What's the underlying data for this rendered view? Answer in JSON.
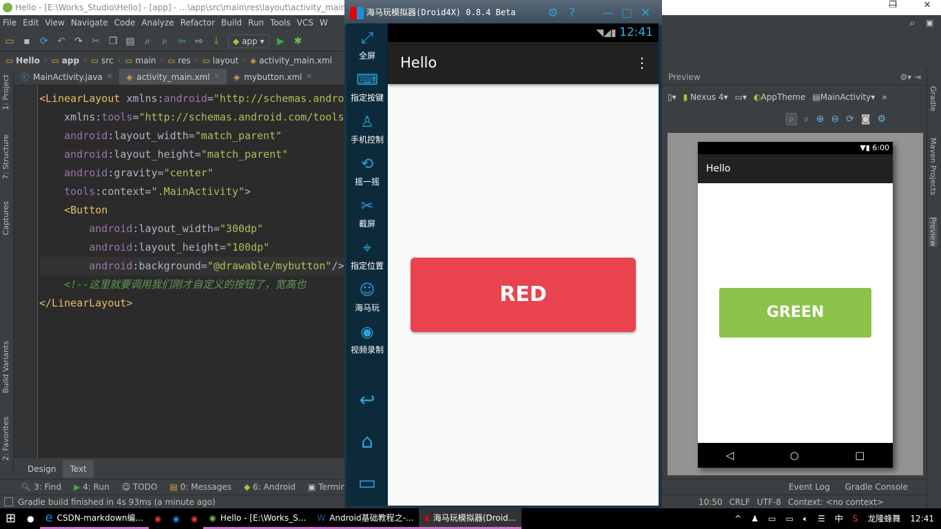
{
  "window": {
    "title": "Hello - [E:\\Works_Studio\\Hello] - [app] - ...\\app\\src\\main\\res\\layout\\activity_main.xml"
  },
  "menu": [
    "File",
    "Edit",
    "View",
    "Navigate",
    "Code",
    "Analyze",
    "Refactor",
    "Build",
    "Run",
    "Tools",
    "VCS",
    "W"
  ],
  "toolbar": {
    "run_config": "app"
  },
  "breadcrumb": [
    "Hello",
    "app",
    "src",
    "main",
    "res",
    "layout",
    "activity_main.xml"
  ],
  "tabs": [
    {
      "label": "MainActivity.java"
    },
    {
      "label": "activity_main.xml",
      "active": true
    },
    {
      "label": "mybutton.xml"
    }
  ],
  "left_tools": [
    "1: Project",
    "7: Structure",
    "Captures",
    "Build Variants",
    "2: Favorites"
  ],
  "code": [
    {
      "parts": [
        [
          "tg",
          "<LinearLayout "
        ],
        [
          "",
          "xmlns:"
        ],
        [
          "at",
          "android"
        ],
        [
          "",
          "="
        ],
        [
          "st",
          "\"http://schemas.andro"
        ]
      ]
    },
    {
      "parts": [
        [
          "",
          "    xmlns:"
        ],
        [
          "at",
          "tools"
        ],
        [
          "",
          "="
        ],
        [
          "st",
          "\"http://schemas.android.com/tools\""
        ]
      ]
    },
    {
      "parts": [
        [
          "at",
          "    android"
        ],
        [
          "",
          ":layout_width="
        ],
        [
          "st",
          "\"match_parent\""
        ]
      ]
    },
    {
      "parts": [
        [
          "at",
          "    android"
        ],
        [
          "",
          ":layout_height="
        ],
        [
          "st",
          "\"match_parent\""
        ]
      ]
    },
    {
      "parts": [
        [
          "at",
          "    android"
        ],
        [
          "",
          ":gravity="
        ],
        [
          "st",
          "\"center\""
        ]
      ]
    },
    {
      "parts": [
        [
          "at",
          "    tools"
        ],
        [
          "",
          ":context="
        ],
        [
          "st",
          "\".MainActivity\""
        ],
        [
          "",
          ">"
        ]
      ]
    },
    {
      "parts": [
        [
          "tg",
          "    <Button"
        ]
      ]
    },
    {
      "parts": [
        [
          "at",
          "        android"
        ],
        [
          "",
          ":layout_width="
        ],
        [
          "st",
          "\"300dp\""
        ]
      ]
    },
    {
      "parts": [
        [
          "at",
          "        android"
        ],
        [
          "",
          ":layout_height="
        ],
        [
          "st",
          "\"100dp\""
        ]
      ]
    },
    {
      "parts": [
        [
          "at",
          "        android"
        ],
        [
          "",
          ":background="
        ],
        [
          "st",
          "\"@drawable/mybutton\""
        ],
        [
          "",
          "/>"
        ]
      ]
    },
    {
      "parts": [
        [
          "cm",
          "    <!--这里就要调用我们刚才自定义的按钮了，宽高也"
        ]
      ]
    },
    {
      "parts": [
        [
          "tg",
          "</LinearLayout>"
        ]
      ]
    }
  ],
  "editor_tabs": {
    "design": "Design",
    "text": "Text"
  },
  "tool_windows": [
    "3: Find",
    "4: Run",
    "TODO",
    "0: Messages",
    "6: Android",
    "Terminal"
  ],
  "tool_windows_right": [
    "Event Log",
    "Gradle Console"
  ],
  "status": {
    "message": "Gradle build finished in 4s 93ms (a minute ago)",
    "position": "10:50",
    "line_sep": "CRLF",
    "encoding": "UTF-8",
    "context": "Context: <no context>"
  },
  "emulator": {
    "title": "海马玩模拟器(Droid4X) 0.8.4 Beta",
    "side": [
      "全屏",
      "指定按键",
      "手机控制",
      "摇一摇",
      "截屏",
      "指定位置",
      "海马玩",
      "视频录制"
    ],
    "time": "12:41",
    "app_title": "Hello",
    "button": "RED",
    "button_color": "#e8434f"
  },
  "preview": {
    "header": "Preview",
    "device": "Nexus 4",
    "theme": "AppTheme",
    "activity": "MainActivity",
    "time": "6:00",
    "app_title": "Hello",
    "button": "GREEN",
    "button_color": "#8bc34a"
  },
  "right_tools": [
    "Gradle",
    "Maven Projects",
    "Preview"
  ],
  "taskbar": {
    "items": [
      "CSDN-markdown编...",
      "Hello - [E:\\Works_S...",
      "Android基础教程之-...",
      "海马玩模拟器(Droid..."
    ],
    "ime": "中",
    "user": "龙隆蜂舞",
    "clock": "12:41"
  }
}
